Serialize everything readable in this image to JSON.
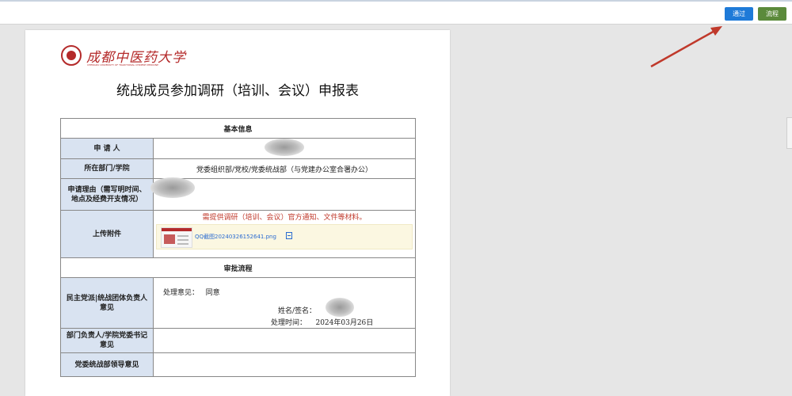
{
  "toolbar": {
    "pass_label": "通过",
    "flow_label": "流程"
  },
  "document": {
    "logo_name": "成都中医药大学",
    "logo_subtitle": "CHENGDU UNIVERSITY OF TRADITIONAL CHINESE MEDICINE",
    "title": "统战成员参加调研（培训、会议）申报表",
    "section_basic": "基本信息",
    "applicant_label": "申 请 人",
    "department_label": "所在部门/学院",
    "department_value": "党委组织部/党校/党委统战部（与党建办公室合署办公）",
    "reason_label": "申请理由（需写明时间、地点及经费开支情况）",
    "attachment_label": "上传附件",
    "attachment_notice": "需提供调研（培训、会议）官方通知、文件等材料。",
    "attachment_filename": "QQ截图20240326152641.png",
    "section_approval": "审批流程",
    "party_leader_label": "民主党派|统战团体负责人意见",
    "opinion_prefix": "处理意见：",
    "opinion_value": "同意",
    "sign_label": "姓名/签名：",
    "time_label": "处理时间：",
    "time_value": "2024年03月26日",
    "dept_head_label": "部门负责人/学院党委书记意见",
    "united_front_label": "党委统战部领导意见"
  }
}
